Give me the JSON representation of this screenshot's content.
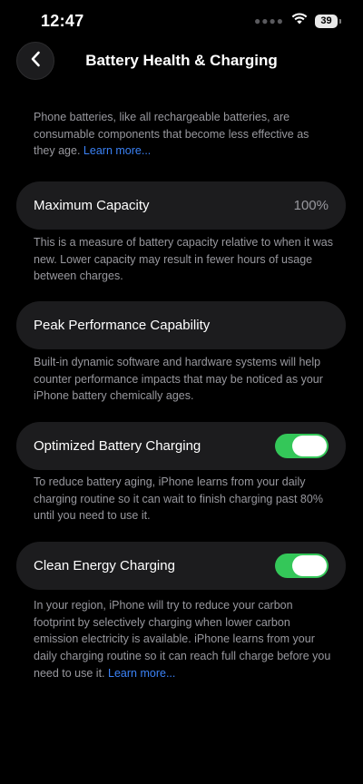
{
  "status_bar": {
    "time": "12:47",
    "battery_level": "39",
    "icons": [
      "dots-icon",
      "wifi-icon",
      "battery-icon"
    ]
  },
  "header": {
    "title": "Battery Health & Charging",
    "back_icon": "chevron-left-icon"
  },
  "intro": {
    "text": "Phone batteries, like all rechargeable batteries, are consumable components that become less effective as they age.",
    "link": "Learn more..."
  },
  "max_capacity": {
    "label": "Maximum Capacity",
    "value": "100%",
    "description": "This is a measure of battery capacity relative to when it was new. Lower capacity may result in fewer hours of usage between charges."
  },
  "peak_performance": {
    "label": "Peak Performance Capability",
    "description": "Built-in dynamic software and hardware systems will help counter performance impacts that may be noticed as your iPhone battery chemically ages."
  },
  "optimized_charging": {
    "label": "Optimized Battery Charging",
    "enabled": true,
    "description": "To reduce battery aging, iPhone learns from your daily charging routine so it can wait to finish charging past 80% until you need to use it."
  },
  "clean_energy": {
    "label": "Clean Energy Charging",
    "enabled": true,
    "description": "In your region, iPhone will try to reduce your carbon footprint by selectively charging when lower carbon emission electricity is available. iPhone learns from your daily charging routine so it can reach full charge before you need to use it.",
    "link": "Learn more..."
  },
  "colors": {
    "background": "#000000",
    "cell": "#1c1c1e",
    "toggle_on": "#34c759",
    "link": "#3b82f6",
    "secondary_text": "#98989e"
  }
}
